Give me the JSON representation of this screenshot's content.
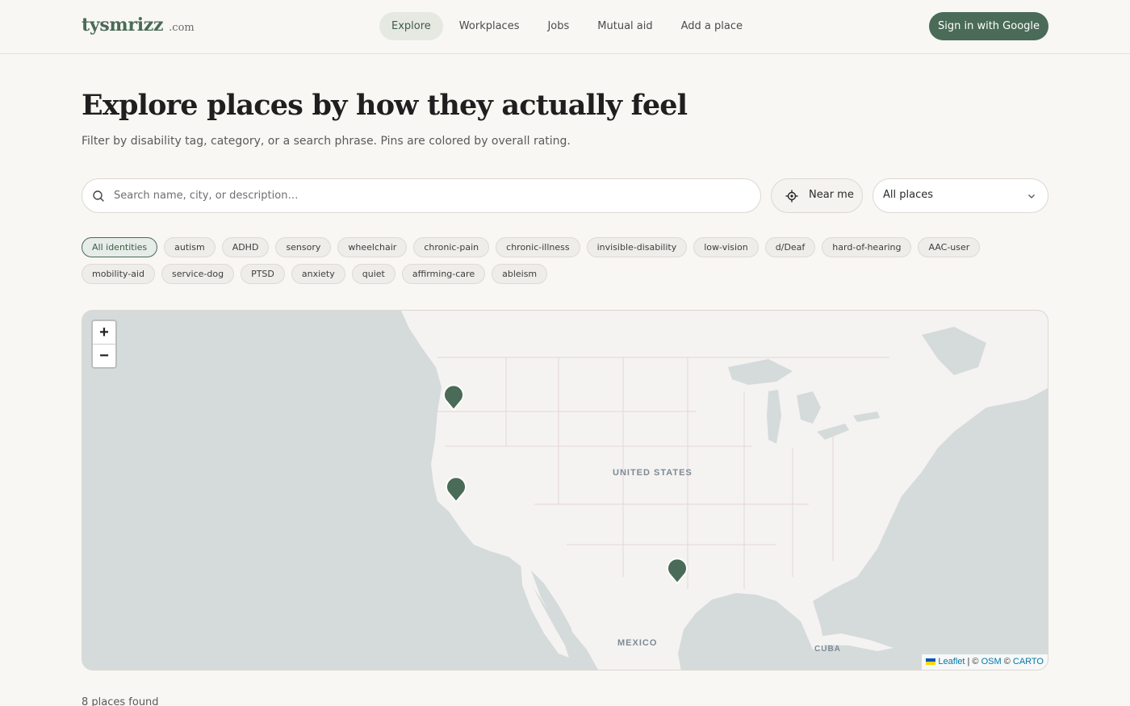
{
  "header": {
    "logo_name": "tysmrizz",
    "logo_tld": ".com",
    "nav": [
      "Explore",
      "Workplaces",
      "Jobs",
      "Mutual aid",
      "Add a place"
    ],
    "active_nav": "Explore",
    "signin_label": "Sign in with Google"
  },
  "hero": {
    "title": "Explore places by how they actually feel",
    "subtitle": "Filter by disability tag, category, or a search phrase. Pins are colored by overall rating."
  },
  "search": {
    "placeholder": "Search name, city, or description…",
    "value": "",
    "near_me_label": "Near me",
    "category_select": "All places"
  },
  "chips": {
    "active": "All identities",
    "items": [
      "All identities",
      "autism",
      "ADHD",
      "sensory",
      "wheelchair",
      "chronic-pain",
      "chronic-illness",
      "invisible-disability",
      "low-vision",
      "d/Deaf",
      "hard-of-hearing",
      "AAC-user",
      "mobility-aid",
      "service-dog",
      "PTSD",
      "anxiety",
      "quiet",
      "affirming-care",
      "ableism"
    ]
  },
  "map": {
    "zoom_in": "+",
    "zoom_out": "−",
    "labels": {
      "country_us": "UNITED STATES",
      "country_mx": "MEXICO",
      "country_cu": "CUBA"
    },
    "pin_color": "#4a6b57",
    "attribution": {
      "leaflet": "Leaflet",
      "sep": "|",
      "copy1": "©",
      "osm": "OSM",
      "copy2": "©",
      "carto": "CARTO"
    }
  },
  "results": {
    "count_text": "8 places found"
  },
  "colors": {
    "brand": "#4a6b57",
    "background": "#f8f7f4"
  }
}
